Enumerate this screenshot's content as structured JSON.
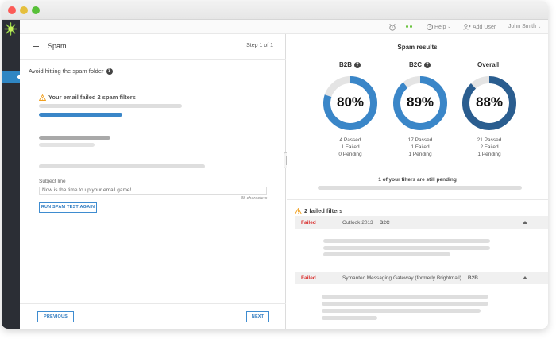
{
  "topbar": {
    "help_label": "Help",
    "add_user_label": "Add User",
    "user_name": "John Smith"
  },
  "left": {
    "title": "Spam",
    "step": "Step 1 of 1",
    "subtitle": "Avoid hitting the spam folder",
    "warning_title": "Your email failed 2 spam filters",
    "subject_label": "Subject line",
    "subject_value": "Now is the time to up your email game!",
    "char_count": "38 characters",
    "run_button": "RUN SPAM TEST AGAIN",
    "previous_button": "PREVIOUS",
    "next_button": "NEXT"
  },
  "results": {
    "title": "Spam results",
    "rings": [
      {
        "label": "B2B",
        "percent": "80%",
        "value": 80,
        "color": "#3a86c8",
        "passed": "4 Passed",
        "failed": "1 Failed",
        "pending": "0 Pending"
      },
      {
        "label": "B2C",
        "percent": "89%",
        "value": 89,
        "color": "#3a86c8",
        "passed": "17 Passed",
        "failed": "1 Failed",
        "pending": "1 Pending"
      },
      {
        "label": "Overall",
        "percent": "88%",
        "value": 88,
        "color": "#2a5d8f",
        "passed": "21 Passed",
        "failed": "2 Failed",
        "pending": "1 Pending"
      }
    ],
    "pending_text": "1 of your filters are still pending",
    "failed_heading": "2 failed filters",
    "failed": [
      {
        "status": "Failed",
        "client": "Outlook 2013",
        "type": "B2C"
      },
      {
        "status": "Failed",
        "client": "Symantec Messaging Gateway (formerly Brightmail)",
        "type": "B2B"
      }
    ]
  },
  "colors": {
    "accent": "#3a86c8",
    "overall": "#2a5d8f",
    "fail": "#d9302f",
    "warning": "#f0a020",
    "sidebar": "#2b2e35"
  }
}
